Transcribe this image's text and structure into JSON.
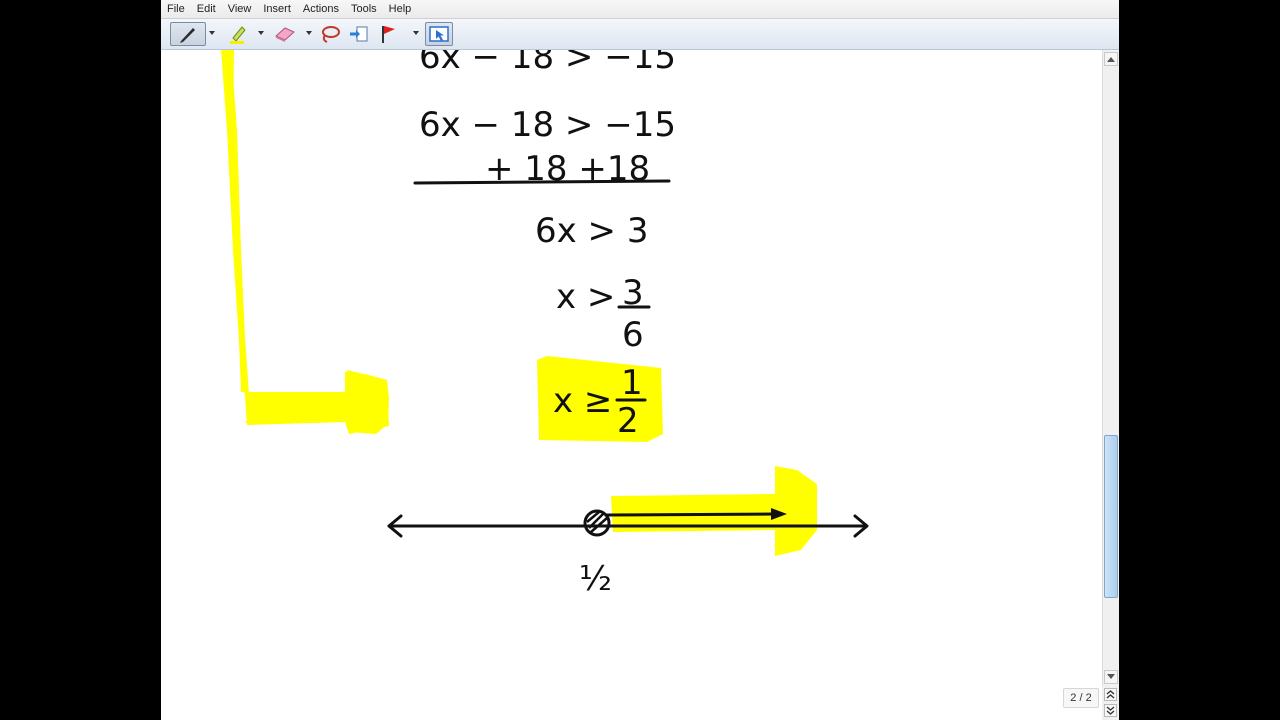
{
  "menu": {
    "items": [
      "File",
      "Edit",
      "View",
      "Insert",
      "Actions",
      "Tools",
      "Help"
    ]
  },
  "toolbar": {
    "tools": [
      "pen-tool",
      "highlighter-tool",
      "eraser-tool",
      "lasso-tool",
      "insert-space-tool",
      "flag-tool",
      "select-tool"
    ]
  },
  "colors": {
    "highlight": "#ffff00",
    "ink": "#111111",
    "scroll_thumb": "#a9cdee"
  },
  "canvas": {
    "lines": {
      "line_top_clipped": "6x − 18 > −15",
      "line1": "6x  −  18 > −15",
      "line2": "+ 18    +18",
      "line3": "6x > 3",
      "line4_lhs": "x >",
      "line4_num": "3",
      "line4_den": "6",
      "line5_lhs": "x ≥",
      "line5_num": "1",
      "line5_den": "2",
      "number_line_label": "½"
    }
  },
  "pagination": {
    "indicator": "2 / 2"
  }
}
